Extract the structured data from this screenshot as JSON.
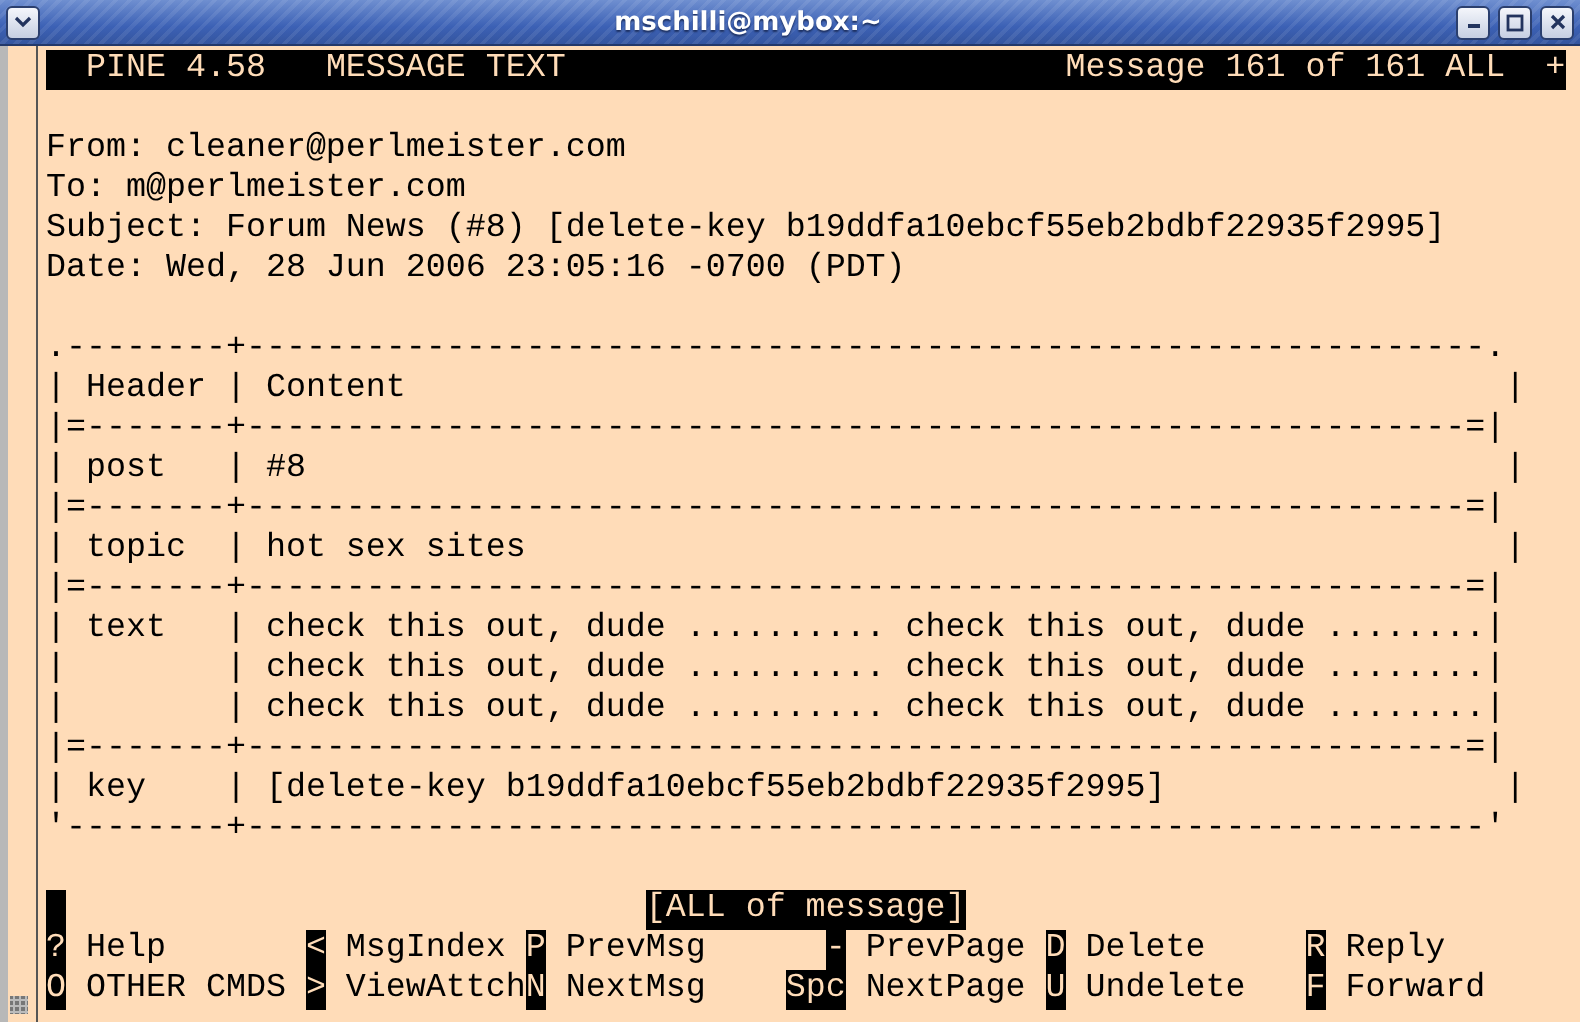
{
  "window": {
    "title": "mschilli@mybox:~"
  },
  "status_bar": {
    "app": "PINE 4.58",
    "screen": "MESSAGE TEXT",
    "position": "Message 161 of 161 ALL",
    "more": "+"
  },
  "headers": [
    "From: cleaner@perlmeister.com",
    "To: m@perlmeister.com",
    "Subject: Forum News (#8) [delete-key b19ddfa10ebcf55eb2bdbf22935f2995]",
    "Date: Wed, 28 Jun 2006 23:05:16 -0700 (PDT)"
  ],
  "body_lines": [
    ".--------+--------------------------------------------------------------.",
    "| Header | Content                                                       |",
    "|=-------+-------------------------------------------------------------=|",
    "| post   | #8                                                            |",
    "|=-------+-------------------------------------------------------------=|",
    "| topic  | hot sex sites                                                 |",
    "|=-------+-------------------------------------------------------------=|",
    "| text   | check this out, dude .......... check this out, dude ........|",
    "|        | check this out, dude .......... check this out, dude ........|",
    "|        | check this out, dude .......... check this out, dude ........|",
    "|=-------+-------------------------------------------------------------=|",
    "| key    | [delete-key b19ddfa10ebcf55eb2bdbf22935f2995]                 |",
    "'--------+--------------------------------------------------------------'"
  ],
  "message_indicator": "[ALL of message]",
  "commands": [
    [
      {
        "key": "?",
        "label": "Help"
      },
      {
        "key": "<",
        "label": "MsgIndex"
      },
      {
        "key": "P",
        "label": "PrevMsg"
      },
      {
        "key": "-",
        "label": "PrevPage"
      },
      {
        "key": "D",
        "label": "Delete"
      },
      {
        "key": "R",
        "label": "Reply"
      }
    ],
    [
      {
        "key": "O",
        "label": "OTHER CMDS"
      },
      {
        "key": ">",
        "label": "ViewAttch"
      },
      {
        "key": "N",
        "label": "NextMsg"
      },
      {
        "key": "Spc",
        "label": "NextPage"
      },
      {
        "key": "U",
        "label": "Undelete"
      },
      {
        "key": "F",
        "label": "Forward"
      }
    ]
  ]
}
